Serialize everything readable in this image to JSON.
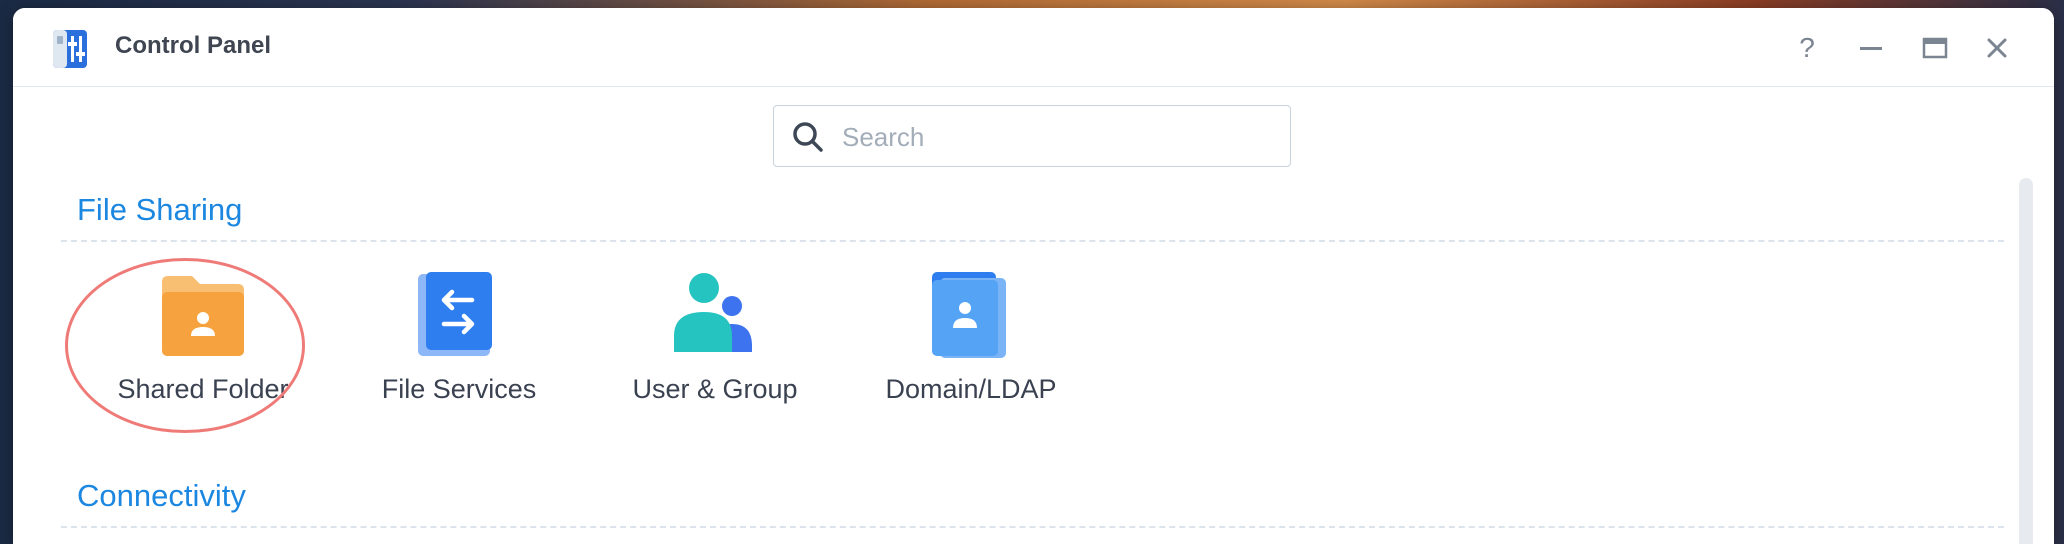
{
  "window": {
    "title": "Control Panel",
    "icon": "control-panel-icon",
    "controls": [
      "help-icon",
      "minimize-icon",
      "maximize-icon",
      "close-icon"
    ]
  },
  "search": {
    "placeholder": "Search",
    "value": ""
  },
  "sections": [
    {
      "title": "File Sharing",
      "items": [
        {
          "label": "Shared Folder",
          "icon": "shared-folder-icon",
          "highlighted": true
        },
        {
          "label": "File Services",
          "icon": "file-services-icon"
        },
        {
          "label": "User & Group",
          "icon": "user-group-icon"
        },
        {
          "label": "Domain/LDAP",
          "icon": "domain-ldap-icon"
        }
      ]
    },
    {
      "title": "Connectivity",
      "items": []
    }
  ],
  "colors": {
    "section_title": "#1c87e0",
    "highlight_ring": "#ef7b78",
    "folder_orange": "#f6a23e",
    "accent_blue": "#2f7ef0"
  }
}
